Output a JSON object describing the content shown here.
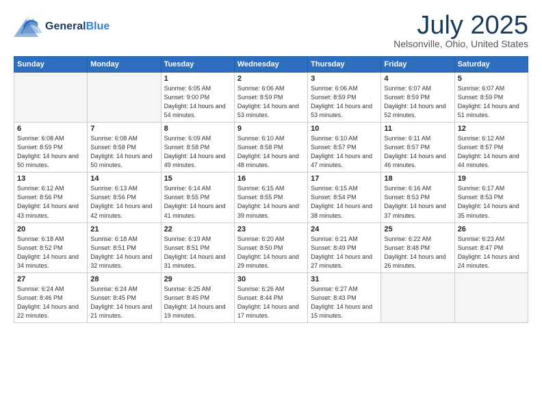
{
  "header": {
    "logo_general": "General",
    "logo_blue": "Blue",
    "month_title": "July 2025",
    "location": "Nelsonville, Ohio, United States"
  },
  "days_of_week": [
    "Sunday",
    "Monday",
    "Tuesday",
    "Wednesday",
    "Thursday",
    "Friday",
    "Saturday"
  ],
  "weeks": [
    [
      {
        "day": "",
        "empty": true
      },
      {
        "day": "",
        "empty": true
      },
      {
        "day": "1",
        "sunrise": "Sunrise: 6:05 AM",
        "sunset": "Sunset: 9:00 PM",
        "daylight": "Daylight: 14 hours and 54 minutes."
      },
      {
        "day": "2",
        "sunrise": "Sunrise: 6:06 AM",
        "sunset": "Sunset: 8:59 PM",
        "daylight": "Daylight: 14 hours and 53 minutes."
      },
      {
        "day": "3",
        "sunrise": "Sunrise: 6:06 AM",
        "sunset": "Sunset: 8:59 PM",
        "daylight": "Daylight: 14 hours and 53 minutes."
      },
      {
        "day": "4",
        "sunrise": "Sunrise: 6:07 AM",
        "sunset": "Sunset: 8:59 PM",
        "daylight": "Daylight: 14 hours and 52 minutes."
      },
      {
        "day": "5",
        "sunrise": "Sunrise: 6:07 AM",
        "sunset": "Sunset: 8:59 PM",
        "daylight": "Daylight: 14 hours and 51 minutes."
      }
    ],
    [
      {
        "day": "6",
        "sunrise": "Sunrise: 6:08 AM",
        "sunset": "Sunset: 8:59 PM",
        "daylight": "Daylight: 14 hours and 50 minutes."
      },
      {
        "day": "7",
        "sunrise": "Sunrise: 6:08 AM",
        "sunset": "Sunset: 8:58 PM",
        "daylight": "Daylight: 14 hours and 50 minutes."
      },
      {
        "day": "8",
        "sunrise": "Sunrise: 6:09 AM",
        "sunset": "Sunset: 8:58 PM",
        "daylight": "Daylight: 14 hours and 49 minutes."
      },
      {
        "day": "9",
        "sunrise": "Sunrise: 6:10 AM",
        "sunset": "Sunset: 8:58 PM",
        "daylight": "Daylight: 14 hours and 48 minutes."
      },
      {
        "day": "10",
        "sunrise": "Sunrise: 6:10 AM",
        "sunset": "Sunset: 8:57 PM",
        "daylight": "Daylight: 14 hours and 47 minutes."
      },
      {
        "day": "11",
        "sunrise": "Sunrise: 6:11 AM",
        "sunset": "Sunset: 8:57 PM",
        "daylight": "Daylight: 14 hours and 46 minutes."
      },
      {
        "day": "12",
        "sunrise": "Sunrise: 6:12 AM",
        "sunset": "Sunset: 8:57 PM",
        "daylight": "Daylight: 14 hours and 44 minutes."
      }
    ],
    [
      {
        "day": "13",
        "sunrise": "Sunrise: 6:12 AM",
        "sunset": "Sunset: 8:56 PM",
        "daylight": "Daylight: 14 hours and 43 minutes."
      },
      {
        "day": "14",
        "sunrise": "Sunrise: 6:13 AM",
        "sunset": "Sunset: 8:56 PM",
        "daylight": "Daylight: 14 hours and 42 minutes."
      },
      {
        "day": "15",
        "sunrise": "Sunrise: 6:14 AM",
        "sunset": "Sunset: 8:55 PM",
        "daylight": "Daylight: 14 hours and 41 minutes."
      },
      {
        "day": "16",
        "sunrise": "Sunrise: 6:15 AM",
        "sunset": "Sunset: 8:55 PM",
        "daylight": "Daylight: 14 hours and 39 minutes."
      },
      {
        "day": "17",
        "sunrise": "Sunrise: 6:15 AM",
        "sunset": "Sunset: 8:54 PM",
        "daylight": "Daylight: 14 hours and 38 minutes."
      },
      {
        "day": "18",
        "sunrise": "Sunrise: 6:16 AM",
        "sunset": "Sunset: 8:53 PM",
        "daylight": "Daylight: 14 hours and 37 minutes."
      },
      {
        "day": "19",
        "sunrise": "Sunrise: 6:17 AM",
        "sunset": "Sunset: 8:53 PM",
        "daylight": "Daylight: 14 hours and 35 minutes."
      }
    ],
    [
      {
        "day": "20",
        "sunrise": "Sunrise: 6:18 AM",
        "sunset": "Sunset: 8:52 PM",
        "daylight": "Daylight: 14 hours and 34 minutes."
      },
      {
        "day": "21",
        "sunrise": "Sunrise: 6:18 AM",
        "sunset": "Sunset: 8:51 PM",
        "daylight": "Daylight: 14 hours and 32 minutes."
      },
      {
        "day": "22",
        "sunrise": "Sunrise: 6:19 AM",
        "sunset": "Sunset: 8:51 PM",
        "daylight": "Daylight: 14 hours and 31 minutes."
      },
      {
        "day": "23",
        "sunrise": "Sunrise: 6:20 AM",
        "sunset": "Sunset: 8:50 PM",
        "daylight": "Daylight: 14 hours and 29 minutes."
      },
      {
        "day": "24",
        "sunrise": "Sunrise: 6:21 AM",
        "sunset": "Sunset: 8:49 PM",
        "daylight": "Daylight: 14 hours and 27 minutes."
      },
      {
        "day": "25",
        "sunrise": "Sunrise: 6:22 AM",
        "sunset": "Sunset: 8:48 PM",
        "daylight": "Daylight: 14 hours and 26 minutes."
      },
      {
        "day": "26",
        "sunrise": "Sunrise: 6:23 AM",
        "sunset": "Sunset: 8:47 PM",
        "daylight": "Daylight: 14 hours and 24 minutes."
      }
    ],
    [
      {
        "day": "27",
        "sunrise": "Sunrise: 6:24 AM",
        "sunset": "Sunset: 8:46 PM",
        "daylight": "Daylight: 14 hours and 22 minutes."
      },
      {
        "day": "28",
        "sunrise": "Sunrise: 6:24 AM",
        "sunset": "Sunset: 8:45 PM",
        "daylight": "Daylight: 14 hours and 21 minutes."
      },
      {
        "day": "29",
        "sunrise": "Sunrise: 6:25 AM",
        "sunset": "Sunset: 8:45 PM",
        "daylight": "Daylight: 14 hours and 19 minutes."
      },
      {
        "day": "30",
        "sunrise": "Sunrise: 6:26 AM",
        "sunset": "Sunset: 8:44 PM",
        "daylight": "Daylight: 14 hours and 17 minutes."
      },
      {
        "day": "31",
        "sunrise": "Sunrise: 6:27 AM",
        "sunset": "Sunset: 8:43 PM",
        "daylight": "Daylight: 14 hours and 15 minutes."
      },
      {
        "day": "",
        "empty": true
      },
      {
        "day": "",
        "empty": true
      }
    ]
  ]
}
